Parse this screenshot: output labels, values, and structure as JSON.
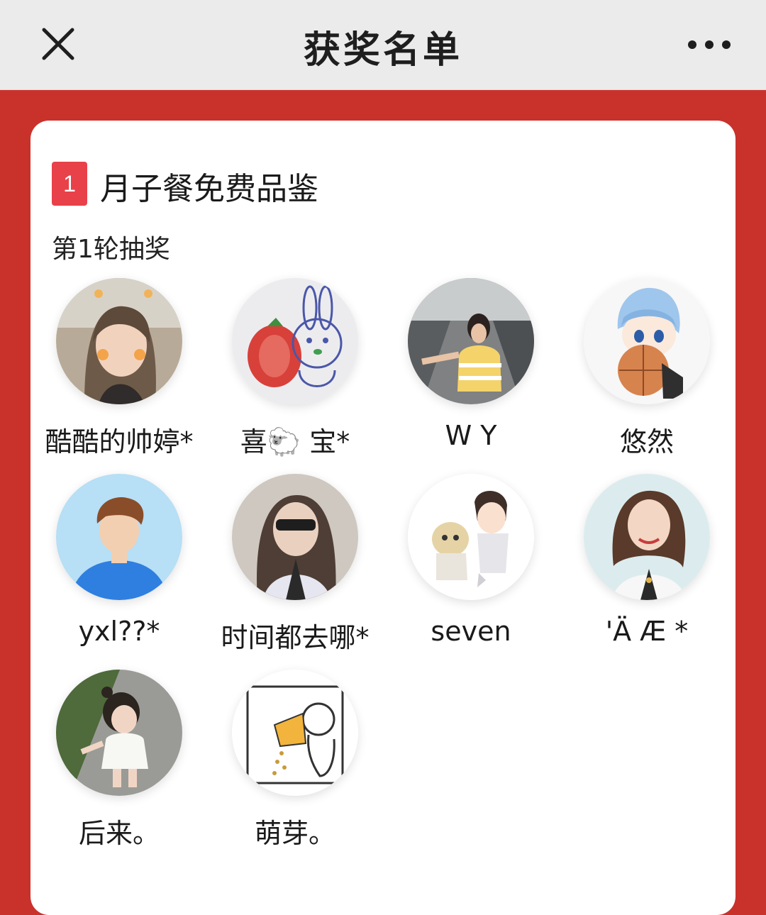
{
  "navbar": {
    "title": "获奖名单",
    "close_icon": "close-icon",
    "more_icon": "more-dots-icon"
  },
  "prize": {
    "index": "1",
    "name": "月子餐免费品鉴",
    "round_label": "第1轮抽奖"
  },
  "winners": [
    {
      "name": "酷酷的帅婷*"
    },
    {
      "name": "喜🐑 宝*"
    },
    {
      "name": "W Y"
    },
    {
      "name": "悠然"
    },
    {
      "name": "yxl??*"
    },
    {
      "name": "时间都去哪*"
    },
    {
      "name": "seven"
    },
    {
      "name": "'Ä Æ *"
    },
    {
      "name": "后来。"
    },
    {
      "name": "萌芽。"
    }
  ],
  "colors": {
    "page_background": "#c9322b",
    "navbar_background": "#ebebeb",
    "index_badge": "#e8414a",
    "card_background": "#ffffff"
  }
}
